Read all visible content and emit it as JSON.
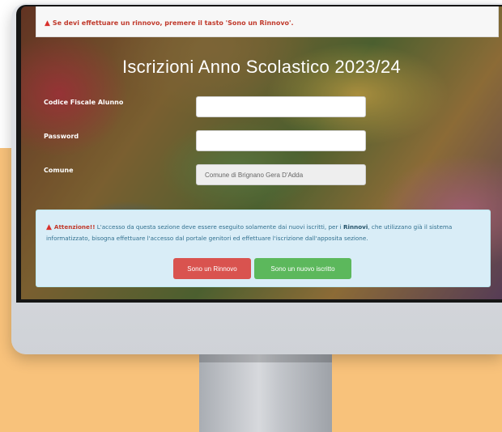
{
  "top_alert": {
    "icon": "warning-triangle-icon",
    "text": "Se devi effettuare un rinnovo, premere il tasto 'Sono un Rinnovo'."
  },
  "page_title": "Iscrizioni Anno Scolastico 2023/24",
  "form": {
    "codice_fiscale_label": "Codice Fiscale Alunno",
    "codice_fiscale_value": "",
    "password_label": "Password",
    "password_value": "",
    "comune_label": "Comune",
    "comune_value": "Comune di Brignano Gera D'Adda"
  },
  "info_panel": {
    "icon": "warning-triangle-icon",
    "attention_label": "Attenzione!!",
    "text_part1": " L'accesso da questa sezione deve essere eseguito solamente dai nuovi iscritti, per i ",
    "rinnovi_word": "Rinnovi",
    "text_part2": ", che utilizzano già il sistema informatizzato, bisogna effettuare l'accesso dal portale genitori ed effettuare l'iscrizione dall'apposita sezione."
  },
  "buttons": {
    "rinnovo_label": "Sono un Rinnovo",
    "nuovo_label": "Sono un nuovo iscritto"
  },
  "colors": {
    "peach_background": "#f8c27b",
    "danger_red": "#d9534f",
    "success_green": "#5cb85c",
    "info_bg": "#d9edf7",
    "info_text": "#31708f"
  }
}
